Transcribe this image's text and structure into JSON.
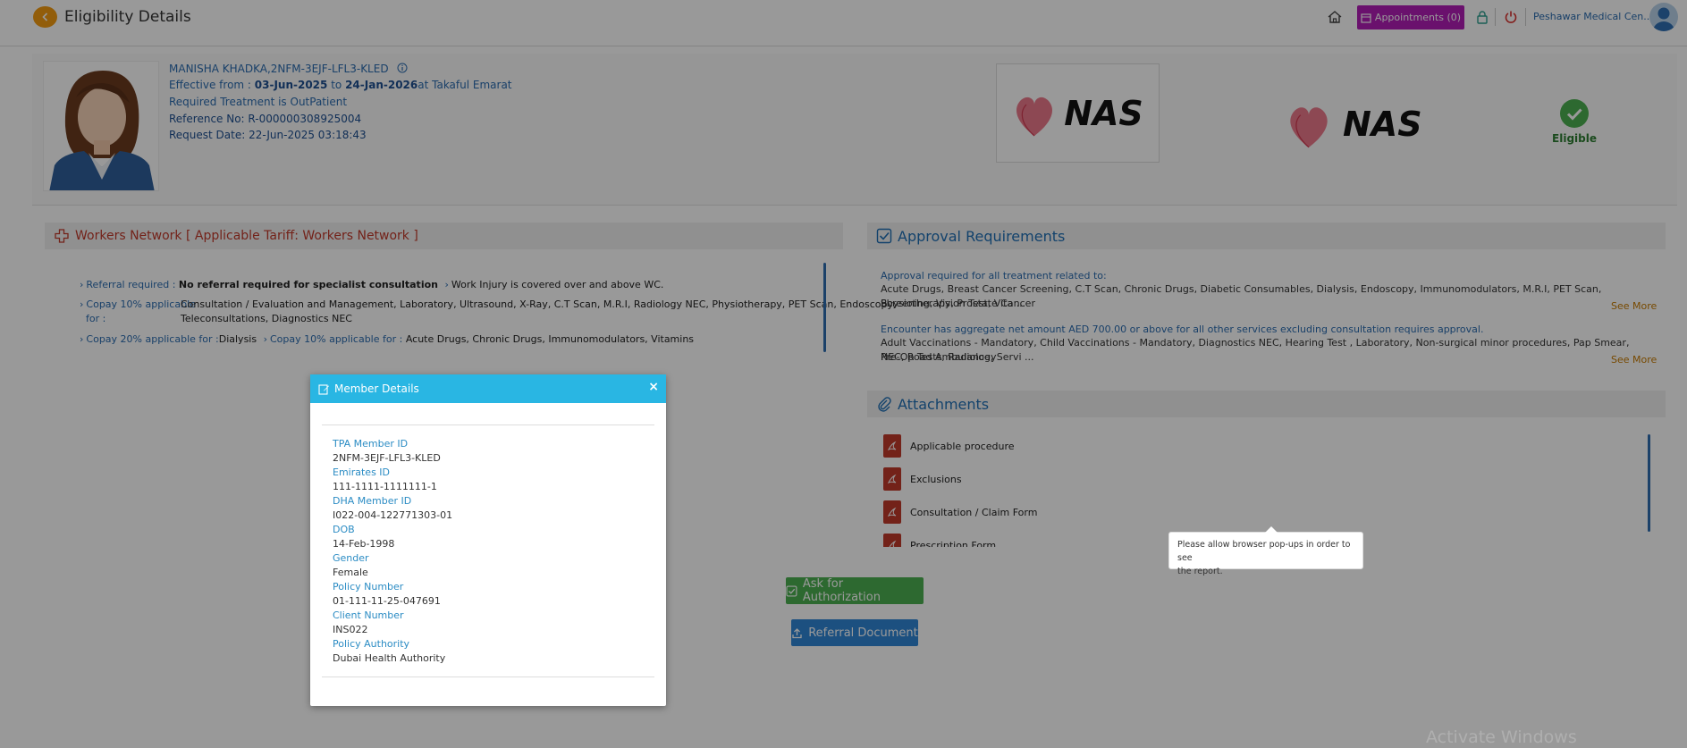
{
  "header": {
    "title": "Eligibility Details",
    "appointments_label": "Appointments (0)",
    "facility": "Peshawar Medical Cen..."
  },
  "member": {
    "name_id": "MANISHA KHADKA,2NFM-3EJF-LFL3-KLED",
    "effective_prefix": "Effective from : ",
    "effective_from": "03-Jun-2025",
    "effective_to_prefix": "to ",
    "effective_to": "24-Jan-2026",
    "effective_at": "at Takaful Emarat",
    "treatment": "Required Treatment is OutPatient",
    "reference": "Reference No: R-000000308925004",
    "request_date": "Request Date: 22-Jun-2025 03:18:43",
    "eligibility_status": "Eligible",
    "logo_text": "NAS"
  },
  "network": {
    "title": "Workers Network [ Applicable Tariff: Workers Network ]",
    "referral_label": "Referral required :",
    "referral_value": "No referral required for specialist consultation",
    "work_injury": "Work Injury is covered over and above WC.",
    "copay10_label_1": "Copay 10% applicable",
    "copay10_label_2": "for :",
    "copay10_value_1": "Consultation / Evaluation and Management, Laboratory, Ultrasound, X-Ray, C.T Scan, M.R.I, Radiology NEC, Physiotherapy, PET Scan, Endoscopy,",
    "copay10_value_2": "Teleconsultations, Diagnostics NEC",
    "copay20_label": "Copay 20% applicable for :",
    "copay20_value": "Dialysis",
    "copay10b_label": "Copay 10% applicable for :",
    "copay10b_value": "Acute Drugs, Chronic Drugs, Immunomodulators, Vitamins"
  },
  "approval": {
    "title": "Approval Requirements",
    "item1_title": "Approval required for all treatment related to:",
    "item1_line1": "Acute Drugs, Breast Cancer Screening, C.T Scan, Chronic Drugs, Diabetic Consumables, Dialysis, Endoscopy, Immunomodulators, M.R.I, PET Scan, Physiotherapy, Prostate Cancer",
    "item1_line2": "Screening, Vision Test, Vita ...",
    "item2_title": "Encounter has aggregate net amount AED 700.00 or above for all other services excluding consultation requires approval.",
    "item2_line1": "Adult Vaccinations - Mandatory, Child Vaccinations - Mandatory, Diagnostics NEC, Hearing Test , Laboratory, Non-surgical minor procedures, Pap Smear, Pre-Op Tests, Radiology",
    "item2_line2": "NEC, Road Ambulance, Servi ...",
    "see_more": "See More"
  },
  "attachments": {
    "title": "Attachments",
    "items": [
      "Applicable procedure",
      "Exclusions",
      "Consultation / Claim Form",
      "Prescription Form"
    ]
  },
  "tooltip": {
    "line1": "Please allow browser pop-ups in order to see",
    "line2": "the report."
  },
  "actions": {
    "ask_auth": "Ask for Authorization",
    "referral_doc": "Referral Document"
  },
  "modal": {
    "title": "Member Details",
    "close": "×",
    "fields": [
      {
        "label": "TPA Member ID",
        "value": "2NFM-3EJF-LFL3-KLED"
      },
      {
        "label": "Emirates ID",
        "value": "111-1111-1111111-1"
      },
      {
        "label": "DHA Member ID",
        "value": "I022-004-122771303-01"
      },
      {
        "label": "DOB",
        "value": "14-Feb-1998"
      },
      {
        "label": "Gender",
        "value": "Female"
      },
      {
        "label": "Policy Number",
        "value": "01-111-11-25-047691"
      },
      {
        "label": "Client Number",
        "value": "INS022"
      },
      {
        "label": "Policy Authority",
        "value": "Dubai Health Authority"
      }
    ]
  },
  "watermark": "Activate Windows",
  "colors": {
    "accent_orange": "#f39c12",
    "appointments_purple": "#b11db6",
    "modal_header": "#29b6e3",
    "eligible_green": "#4caf50",
    "link_blue": "#2b6cb0"
  },
  "icons": [
    "back-arrow-icon",
    "home-icon",
    "calendar-icon",
    "lock-icon",
    "power-icon",
    "user-avatar-icon",
    "info-icon",
    "medical-cross-icon",
    "checkbox-icon",
    "paperclip-icon",
    "pdf-icon",
    "check-circle-icon",
    "edit-icon",
    "close-icon",
    "chevron-right-icon",
    "upload-icon"
  ]
}
